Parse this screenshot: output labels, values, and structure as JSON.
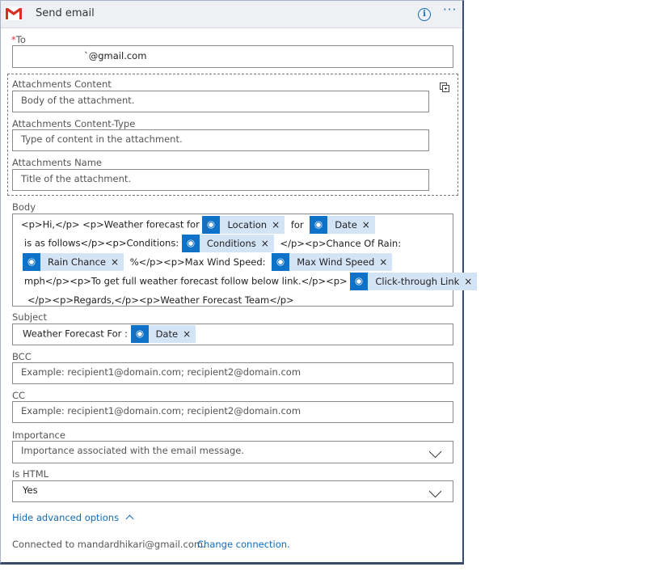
{
  "header": {
    "title": "Send email",
    "logo": "gmail-logo",
    "info_icon": "info-icon",
    "more_icon": "more-options-icon"
  },
  "to": {
    "required_mark": "*",
    "label": "To",
    "value": "`@gmail.com"
  },
  "attachments": {
    "content_label": "Attachments Content",
    "content_placeholder": "Body of the attachment.",
    "type_label": "Attachments Content-Type",
    "type_placeholder": "Type of content in the attachment.",
    "name_label": "Attachments Name",
    "name_placeholder": "Title of the attachment."
  },
  "body": {
    "label": "Body",
    "t1": "<p>Hi,</p>  <p>Weather forecast for",
    "tok_location": "Location",
    "t2": "for",
    "tok_date": "Date",
    "t3": "is as follows</p><p>Conditions:",
    "tok_conditions": "Conditions",
    "t4": "</p><p>Chance Of Rain:",
    "tok_rain": "Rain Chance",
    "t5": "%</p><p>Max Wind Speed:",
    "tok_wind": "Max Wind Speed",
    "t6": "mph</p><p>To get full weather forecast follow below link.</p><p>",
    "tok_link": "Click-through Link",
    "t7": "</p><p>Regards,</p><p>Weather Forecast Team</p>",
    "remove_glyph": "×"
  },
  "subject": {
    "label": "Subject",
    "prefix": "Weather Forecast For :",
    "tok_date": "Date"
  },
  "bcc": {
    "label": "BCC",
    "placeholder": "Example: recipient1@domain.com; recipient2@domain.com"
  },
  "cc": {
    "label": "CC",
    "placeholder": "Example: recipient1@domain.com; recipient2@domain.com"
  },
  "importance": {
    "label": "Importance",
    "placeholder": "Importance associated with the email message."
  },
  "is_html": {
    "label": "Is HTML",
    "value": "Yes"
  },
  "advanced": {
    "label": "Hide advanced options"
  },
  "footer": {
    "connected": "Connected to mandardhikari@gmail.com.",
    "change": "Change connection."
  },
  "colors": {
    "accent": "#0f6bbb",
    "token_bg": "#d4e4f7",
    "token_icon": "#0f72c9",
    "required": "#d13438"
  }
}
